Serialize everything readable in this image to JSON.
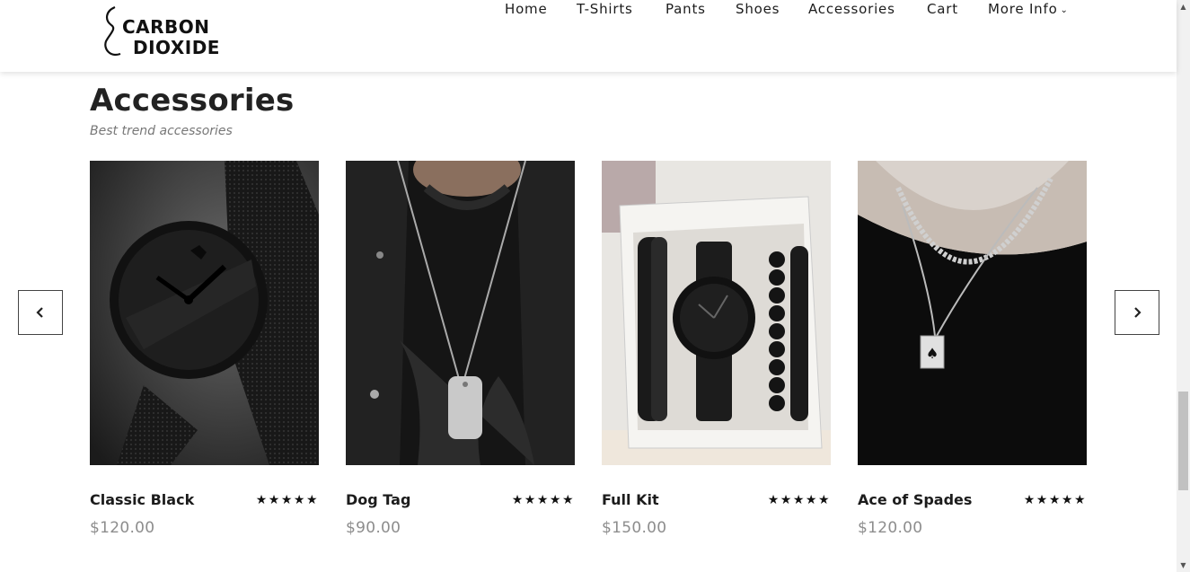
{
  "brand": {
    "line1": "CARBON",
    "line2": "DIOXIDE"
  },
  "nav": {
    "items": [
      "Home",
      "T-Shirts",
      "Pants",
      "Shoes",
      "Accessories",
      "Cart"
    ],
    "more_label": "More Info"
  },
  "section": {
    "title": "Accessories",
    "subtitle": "Best trend accessories"
  },
  "products": [
    {
      "name": "Classic Black",
      "price": "$120.00",
      "stars": "★★★★★",
      "rating": 5,
      "image": "black mesh watch"
    },
    {
      "name": "Dog Tag",
      "price": "$90.00",
      "stars": "★★★★★",
      "rating": 5,
      "image": "dog tag necklace"
    },
    {
      "name": "Full Kit",
      "price": "$150.00",
      "stars": "★★★★★",
      "rating": 5,
      "image": "watch and bracelet gift box"
    },
    {
      "name": "Ace of Spades",
      "price": "$120.00",
      "stars": "★★★★★",
      "rating": 5,
      "image": "ace of spades chain necklace"
    }
  ],
  "icons": {
    "prev": "chevron-left-icon",
    "next": "chevron-right-icon",
    "dropdown": "chevron-down-icon"
  },
  "colors": {
    "text": "#1c1c1c",
    "price": "#8d8d8d",
    "subtitle": "#777777"
  }
}
